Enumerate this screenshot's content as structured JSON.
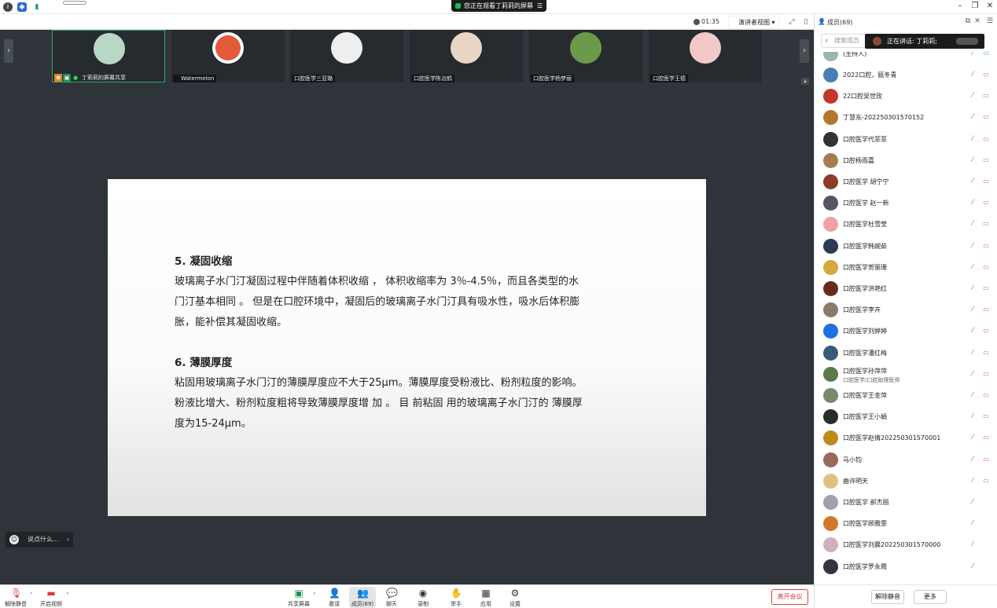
{
  "share_banner": {
    "text": "您正在观看丁莉莉的屏幕",
    "menu_icon": "menu-lines-icon"
  },
  "meeting_bar": {
    "timer": "01:35",
    "layout": "演讲者视图"
  },
  "video_tiles": [
    {
      "name": "丁莉莉的屏幕共享",
      "avatar_color": "#b9d7c5",
      "active": true
    },
    {
      "name": "Watermelon",
      "avatar_color": "#e25a3a",
      "active": false
    },
    {
      "name": "口腔医学三亚璐",
      "avatar_color": "#d8d8d8",
      "active": false
    },
    {
      "name": "口腔医学陈治鹤",
      "avatar_color": "#e9d6c4",
      "active": false
    },
    {
      "name": "口腔医学杨梦丽",
      "avatar_color": "#6c9a4a",
      "active": false
    },
    {
      "name": "口腔医学王德",
      "avatar_color": "#f1c9c9",
      "active": false
    }
  ],
  "slide": {
    "sec5_title": "5. 凝固收缩",
    "sec5_lines": [
      "玻璃离子水门汀凝固过程中伴随着体积收缩 ， 体积收缩率为 3％-4.5％，而且各类型的水",
      "门汀基本相同 。 但是在口腔环境中，凝固后的玻璃离子水门汀具有吸水性，吸水后体积膨",
      "胀，能补偿其凝固收缩。"
    ],
    "sec6_title": "6. 薄膜厚度",
    "sec6_lines": [
      "粘固用玻璃离子水门汀的薄膜厚度应不大于25μm。薄膜厚度受粉液比、粉剂粒度的影响。",
      "粉液比增大、粉剂粒度粗将导致薄膜厚度增 加 。 目 前粘固 用的玻璃离子水门汀的 薄膜厚",
      "度为15-24μm。"
    ]
  },
  "chat_pill": {
    "placeholder": "说点什么..."
  },
  "bottom_bar": {
    "mute": "解除静音",
    "video": "开启视频",
    "share": "共享屏幕",
    "invite": "邀请",
    "members": "成员(69)",
    "chat": "聊天",
    "record": "录制",
    "raise_hand": "举手",
    "apps": "应用",
    "settings": "设置",
    "leave": "离开会议"
  },
  "right_panel": {
    "title": "成员(69)",
    "search_placeholder": "搜索成员",
    "speaking": "正在讲话: 丁莉莉;",
    "participants": [
      {
        "name": "(主持人)",
        "color": "#9bb7a6",
        "muted": false
      },
      {
        "name": "2022口腔，瓯冬青",
        "color": "#4a7fb5",
        "muted": true
      },
      {
        "name": "22口腔吴世玫",
        "color": "#c0392b",
        "muted": true
      },
      {
        "name": "丁慧东-202250301570152",
        "color": "#b5772b",
        "muted": true
      },
      {
        "name": "口腔医学代菲菲",
        "color": "#333333",
        "muted": true
      },
      {
        "name": "口腔杨雨嘉",
        "color": "#a67c52",
        "muted": true
      },
      {
        "name": "口腔医学 胡宁宁",
        "color": "#8e3b2a",
        "muted": true
      },
      {
        "name": "口腔医学 赵一新",
        "color": "#555566",
        "muted": true
      },
      {
        "name": "口腔医学杜雪莹",
        "color": "#f0a0a8",
        "muted": true
      },
      {
        "name": "口腔医学韩婉茹",
        "color": "#2b3a55",
        "muted": true
      },
      {
        "name": "口腔医学贺丽珊",
        "color": "#d4a83a",
        "muted": true
      },
      {
        "name": "口腔医学洪艳红",
        "color": "#6a2a1a",
        "muted": true
      },
      {
        "name": "口腔医学李卉",
        "color": "#8a7a6a",
        "muted": true
      },
      {
        "name": "口腔医学刘婷婷",
        "color": "#1e6fe0",
        "muted": true
      },
      {
        "name": "口腔医学潘红梅",
        "color": "#3a5a7a",
        "muted": true
      },
      {
        "name": "口腔医学孙萍萍",
        "sub": "口腔医学/口腔助理医师",
        "color": "#5a7a4a",
        "muted": true
      },
      {
        "name": "口腔医学王金萍",
        "color": "#7a8a6a",
        "muted": true
      },
      {
        "name": "口腔医学王小娟",
        "color": "#2a2a2a",
        "muted": true
      },
      {
        "name": "口腔医学赵倩202250301570001",
        "color": "#c08a1a",
        "muted": true
      },
      {
        "name": "马小钧",
        "color": "#9a6a5a",
        "muted": true
      },
      {
        "name": "曲许明天",
        "color": "#e0c080",
        "muted": true
      },
      {
        "name": "口腔医学 郝杰丽",
        "color": "#a0a0b0",
        "muted": false
      },
      {
        "name": "口腔医学顾雅雯",
        "color": "#d07a2a",
        "muted": false
      },
      {
        "name": "口腔医学刘晨202250301570000",
        "color": "#d0b0c0",
        "muted": false
      },
      {
        "name": "口腔医学罗永霞",
        "color": "#333344",
        "muted": false
      }
    ],
    "footer": {
      "unmute_all": "解除静音",
      "more": "更多"
    }
  }
}
